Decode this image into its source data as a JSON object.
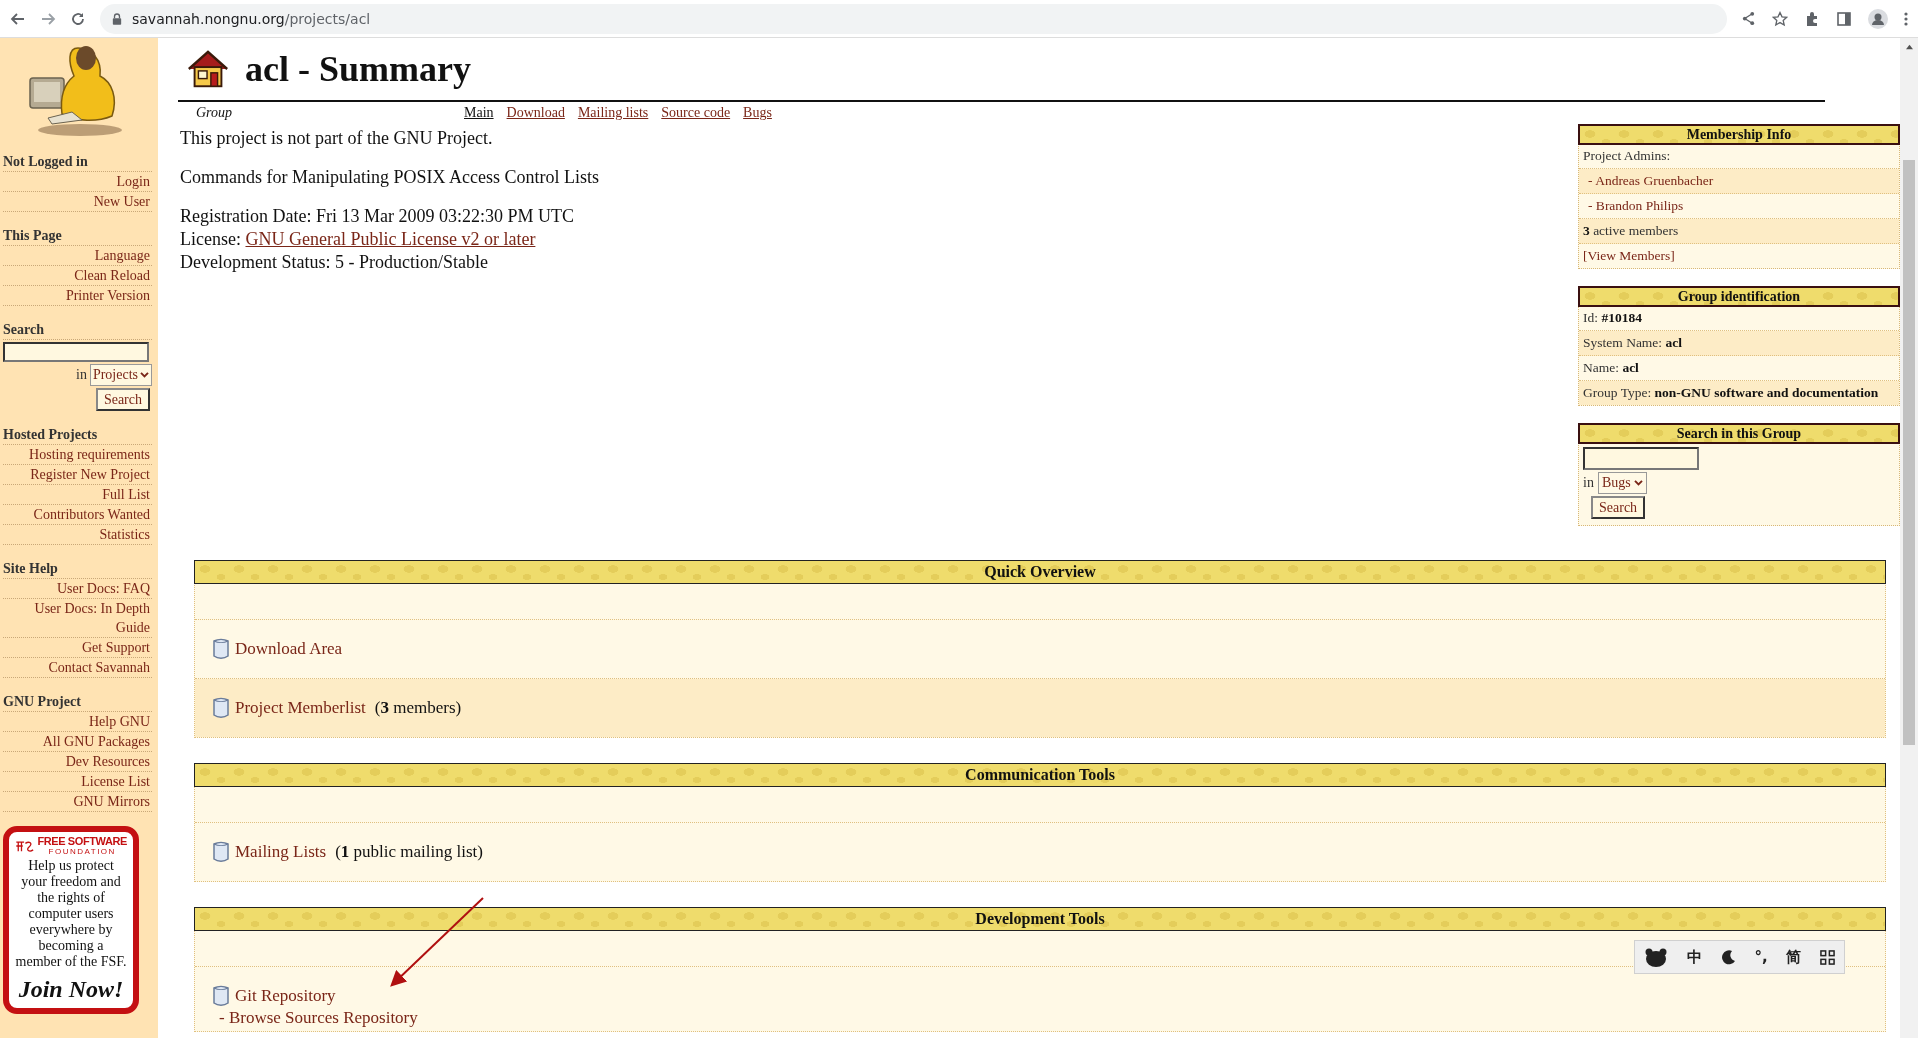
{
  "browser": {
    "url_host": "savannah.nongnu.org",
    "url_path": "/projects/acl"
  },
  "sidebar": {
    "sections": [
      {
        "kind": "links",
        "title": "Not Logged in",
        "items": [
          "Login",
          "New User"
        ]
      },
      {
        "kind": "links",
        "title": "This Page",
        "items": [
          "Language",
          "Clean Reload",
          "Printer Version"
        ]
      },
      {
        "kind": "search",
        "title": "Search",
        "in_label": "in",
        "scope": "Projects",
        "button": "Search"
      },
      {
        "kind": "links",
        "title": "Hosted Projects",
        "items": [
          "Hosting requirements",
          "Register New Project",
          "Full List",
          "Contributors Wanted",
          "Statistics"
        ]
      },
      {
        "kind": "links",
        "title": "Site Help",
        "items": [
          "User Docs: FAQ",
          "User Docs: In Depth Guide",
          "Get Support",
          "Contact Savannah"
        ]
      },
      {
        "kind": "links",
        "title": "GNU Project",
        "items": [
          "Help GNU",
          "All GNU Packages",
          "Dev Resources",
          "License List",
          "GNU Mirrors"
        ]
      }
    ],
    "fsf": {
      "logo": "FREE SOFTWARE",
      "logo_sub": "FOUNDATION",
      "text": "Help us protect your freedom and the rights of computer users everywhere by becoming a member of the FSF.",
      "cta": "Join Now!"
    }
  },
  "project": {
    "title": "acl - Summary",
    "group_label": "Group",
    "nav": [
      {
        "label": "Main",
        "selected": true
      },
      {
        "label": "Download",
        "selected": false
      },
      {
        "label": "Mailing lists",
        "selected": false
      },
      {
        "label": "Source code",
        "selected": false
      },
      {
        "label": "Bugs",
        "selected": false
      }
    ],
    "notice": "This project is not part of the GNU Project.",
    "description": "Commands for Manipulating POSIX Access Control Lists",
    "details": [
      {
        "label": "Registration Date:",
        "value": "Fri 13 Mar 2009 03:22:30 PM UTC"
      },
      {
        "label": "License:",
        "link": "GNU General Public License v2 or later"
      },
      {
        "label": "Development Status:",
        "value": "5 - Production/Stable"
      }
    ]
  },
  "side_boxes": [
    {
      "kind": "list",
      "title": "Membership Info",
      "rows": [
        {
          "text": "Project Admins:",
          "link": false
        },
        {
          "text": "- Andreas Gruenbacher",
          "link": true
        },
        {
          "text": "- Brandon Philips",
          "link": true
        },
        {
          "text": "**3** active members",
          "link": false
        },
        {
          "text": "[View Members]",
          "link": true
        }
      ]
    },
    {
      "kind": "list",
      "title": "Group identification",
      "rows": [
        {
          "text": "Id: **#10184**",
          "link": false
        },
        {
          "text": "System Name: **acl**",
          "link": false
        },
        {
          "text": "Name: **acl**",
          "link": false
        },
        {
          "text": "Group Type: **non-GNU software and documentation**",
          "link": false
        }
      ]
    },
    {
      "kind": "search",
      "title": "Search in this Group",
      "in_label": "in",
      "scope": "Bugs",
      "button": "Search"
    }
  ],
  "sections": [
    {
      "title": "Quick Overview",
      "items": [
        {
          "link": "Download Area"
        },
        {
          "link": "Project Memberlist",
          "note": "(**3** members)"
        }
      ]
    },
    {
      "title": "Communication Tools",
      "items": [
        {
          "link": "Mailing Lists",
          "note": "(**1** public mailing list)"
        }
      ]
    },
    {
      "title": "Development Tools",
      "items": [
        {
          "link": "Git Repository",
          "sublinks": [
            "- Browse Sources Repository"
          ]
        }
      ]
    }
  ],
  "ime_toolbar": {
    "items": [
      {
        "kind": "paw"
      },
      {
        "kind": "text",
        "text": "中"
      },
      {
        "kind": "moon"
      },
      {
        "kind": "text",
        "text": "°,"
      },
      {
        "kind": "text",
        "text": "简"
      },
      {
        "kind": "grid"
      }
    ]
  }
}
